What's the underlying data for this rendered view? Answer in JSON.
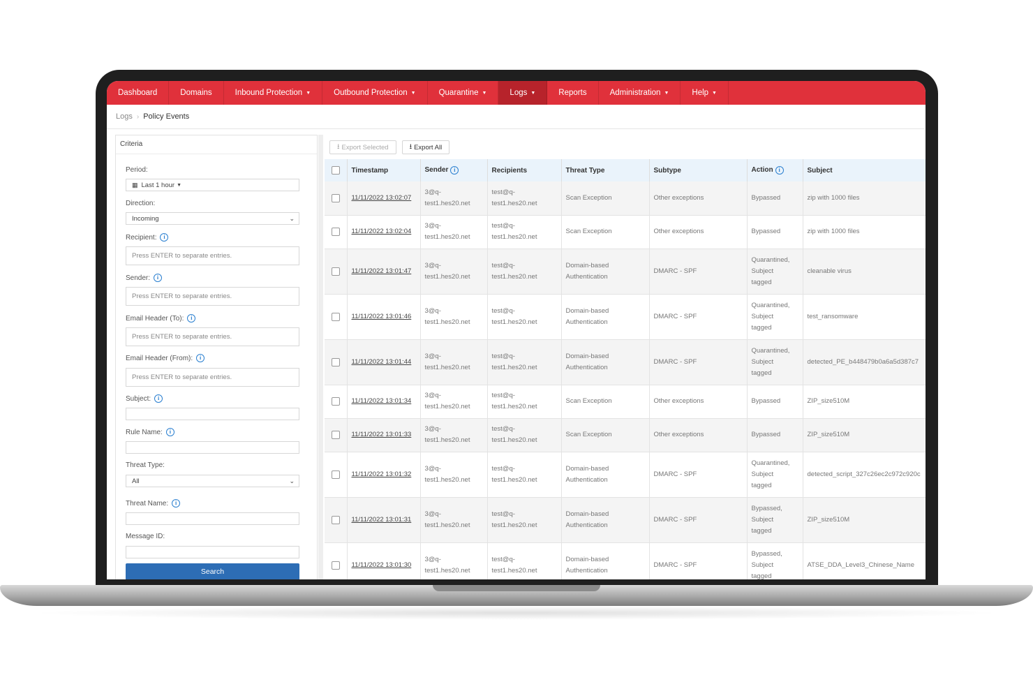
{
  "nav": [
    {
      "label": "Dashboard",
      "has_caret": false,
      "active": false
    },
    {
      "label": "Domains",
      "has_caret": false,
      "active": false
    },
    {
      "label": "Inbound Protection",
      "has_caret": true,
      "active": false
    },
    {
      "label": "Outbound Protection",
      "has_caret": true,
      "active": false
    },
    {
      "label": "Quarantine",
      "has_caret": true,
      "active": false
    },
    {
      "label": "Logs",
      "has_caret": true,
      "active": true
    },
    {
      "label": "Reports",
      "has_caret": false,
      "active": false
    },
    {
      "label": "Administration",
      "has_caret": true,
      "active": false
    },
    {
      "label": "Help",
      "has_caret": true,
      "active": false
    }
  ],
  "breadcrumb": {
    "parent": "Logs",
    "current": "Policy Events"
  },
  "criteria": {
    "title": "Criteria",
    "period_label": "Period:",
    "period_value": "Last 1 hour",
    "direction_label": "Direction:",
    "direction_value": "Incoming",
    "recipient_label": "Recipient:",
    "recipient_placeholder": "Press ENTER to separate entries.",
    "sender_label": "Sender:",
    "sender_placeholder": "Press ENTER to separate entries.",
    "header_to_label": "Email Header (To):",
    "header_to_placeholder": "Press ENTER to separate entries.",
    "header_from_label": "Email Header (From):",
    "header_from_placeholder": "Press ENTER to separate entries.",
    "subject_label": "Subject:",
    "rule_name_label": "Rule Name:",
    "threat_type_label": "Threat Type:",
    "threat_type_value": "All",
    "threat_name_label": "Threat Name:",
    "message_id_label": "Message ID:",
    "search_label": "Search"
  },
  "toolbar": {
    "export_selected": "Export Selected",
    "export_all": "Export All"
  },
  "table": {
    "columns": [
      "Timestamp",
      "Sender",
      "Recipients",
      "Threat Type",
      "Subtype",
      "Action",
      "Subject"
    ],
    "rows": [
      {
        "timestamp": "11/11/2022 13:02:07",
        "sender": [
          "3@q-",
          "test1.hes20.net"
        ],
        "recipients": [
          "test@q-",
          "test1.hes20.net"
        ],
        "threat_type": [
          "Scan Exception"
        ],
        "subtype": "Other exceptions",
        "action": [
          "Bypassed"
        ],
        "subject": "zip with 1000 files"
      },
      {
        "timestamp": "11/11/2022 13:02:04",
        "sender": [
          "3@q-",
          "test1.hes20.net"
        ],
        "recipients": [
          "test@q-",
          "test1.hes20.net"
        ],
        "threat_type": [
          "Scan Exception"
        ],
        "subtype": "Other exceptions",
        "action": [
          "Bypassed"
        ],
        "subject": "zip with 1000 files"
      },
      {
        "timestamp": "11/11/2022 13:01:47",
        "sender": [
          "3@q-",
          "test1.hes20.net"
        ],
        "recipients": [
          "test@q-",
          "test1.hes20.net"
        ],
        "threat_type": [
          "Domain-based",
          "Authentication"
        ],
        "subtype": "DMARC - SPF",
        "action": [
          "Quarantined,",
          "Subject",
          "tagged"
        ],
        "subject": "cleanable virus"
      },
      {
        "timestamp": "11/11/2022 13:01:46",
        "sender": [
          "3@q-",
          "test1.hes20.net"
        ],
        "recipients": [
          "test@q-",
          "test1.hes20.net"
        ],
        "threat_type": [
          "Domain-based",
          "Authentication"
        ],
        "subtype": "DMARC - SPF",
        "action": [
          "Quarantined,",
          "Subject",
          "tagged"
        ],
        "subject": "test_ransomware"
      },
      {
        "timestamp": "11/11/2022 13:01:44",
        "sender": [
          "3@q-",
          "test1.hes20.net"
        ],
        "recipients": [
          "test@q-",
          "test1.hes20.net"
        ],
        "threat_type": [
          "Domain-based",
          "Authentication"
        ],
        "subtype": "DMARC - SPF",
        "action": [
          "Quarantined,",
          "Subject",
          "tagged"
        ],
        "subject": "detected_PE_b448479b0a6a5d387c7"
      },
      {
        "timestamp": "11/11/2022 13:01:34",
        "sender": [
          "3@q-",
          "test1.hes20.net"
        ],
        "recipients": [
          "test@q-",
          "test1.hes20.net"
        ],
        "threat_type": [
          "Scan Exception"
        ],
        "subtype": "Other exceptions",
        "action": [
          "Bypassed"
        ],
        "subject": "ZIP_size510M"
      },
      {
        "timestamp": "11/11/2022 13:01:33",
        "sender": [
          "3@q-",
          "test1.hes20.net"
        ],
        "recipients": [
          "test@q-",
          "test1.hes20.net"
        ],
        "threat_type": [
          "Scan Exception"
        ],
        "subtype": "Other exceptions",
        "action": [
          "Bypassed"
        ],
        "subject": "ZIP_size510M"
      },
      {
        "timestamp": "11/11/2022 13:01:32",
        "sender": [
          "3@q-",
          "test1.hes20.net"
        ],
        "recipients": [
          "test@q-",
          "test1.hes20.net"
        ],
        "threat_type": [
          "Domain-based",
          "Authentication"
        ],
        "subtype": "DMARC - SPF",
        "action": [
          "Quarantined,",
          "Subject",
          "tagged"
        ],
        "subject": "detected_script_327c26ec2c972c920c"
      },
      {
        "timestamp": "11/11/2022 13:01:31",
        "sender": [
          "3@q-",
          "test1.hes20.net"
        ],
        "recipients": [
          "test@q-",
          "test1.hes20.net"
        ],
        "threat_type": [
          "Domain-based",
          "Authentication"
        ],
        "subtype": "DMARC - SPF",
        "action": [
          "Bypassed,",
          "Subject",
          "tagged"
        ],
        "subject": "ZIP_size510M"
      },
      {
        "timestamp": "11/11/2022 13:01:30",
        "sender": [
          "3@q-",
          "test1.hes20.net"
        ],
        "recipients": [
          "test@q-",
          "test1.hes20.net"
        ],
        "threat_type": [
          "Domain-based",
          "Authentication"
        ],
        "subtype": "DMARC - SPF",
        "action": [
          "Bypassed,",
          "Subject",
          "tagged"
        ],
        "subject": "ATSE_DDA_Level3_Chinese_Name"
      }
    ]
  },
  "colors": {
    "nav_bg": "#e0313b",
    "nav_active": "#b7232b",
    "search_button": "#2d6db5",
    "table_header": "#eaf3fb",
    "info_icon": "#2a7fd0"
  },
  "icons": {
    "calendar": "calendar-icon",
    "download": "download-icon",
    "info": "info-icon",
    "dropdown": "chevron-down-icon"
  }
}
